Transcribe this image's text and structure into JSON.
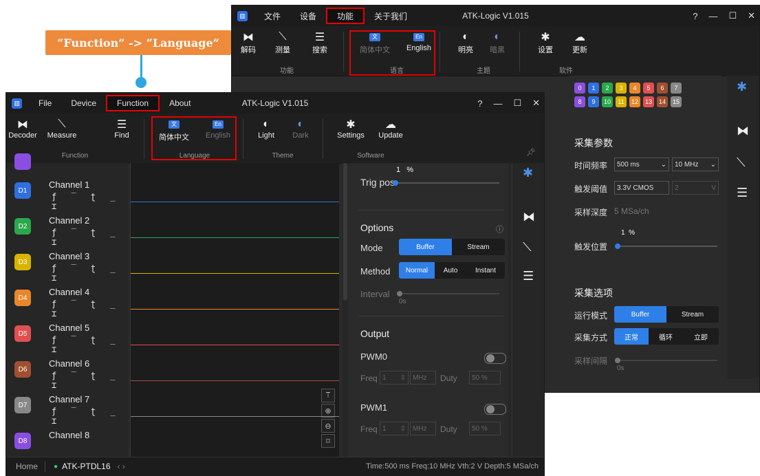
{
  "callout": {
    "text": "“Function” -> “Language”"
  },
  "back_window": {
    "title": "ATK-Logic  V1.015",
    "menu": [
      "文件",
      "设备",
      "功能",
      "关于我们"
    ],
    "controls": [
      "?",
      "—",
      "☐",
      "✕"
    ],
    "ribbon": {
      "decoder": "解码",
      "measure": "测量",
      "find": "搜索",
      "group_function": "功能",
      "lang_cn": "简体中文",
      "lang_en": "English",
      "group_language": "语言",
      "light": "明亮",
      "dark": "暗黑",
      "group_theme": "主题",
      "settings": "设置",
      "update": "更新",
      "group_software": "软件"
    },
    "channel_chips": [
      "0",
      "1",
      "2",
      "3",
      "4",
      "5",
      "6",
      "7",
      "8",
      "9",
      "10",
      "11",
      "12",
      "13",
      "14",
      "15"
    ],
    "chip_colors": [
      "#8a4fe0",
      "#2f6fe0",
      "#2aa84a",
      "#d8b400",
      "#e8872a",
      "#e05050",
      "#a05030",
      "#888888",
      "#8a4fe0",
      "#2f6fe0",
      "#2aa84a",
      "#d8b400",
      "#e8872a",
      "#e05050",
      "#a05030",
      "#888888"
    ],
    "acq_params_title": "采集参数",
    "time_freq_label": "时间频率",
    "time_value": "500 ms",
    "freq_value": "10 MHz",
    "trig_threshold_label": "触发阈值",
    "threshold_value": "3.3V CMOS",
    "threshold_num": "2",
    "threshold_unit": "V",
    "depth_label": "采样深度",
    "depth_value": "5 MSa/ch",
    "trig_pos_label": "触发位置",
    "trig_pos_value": "1",
    "trig_pos_unit": "%",
    "options_title": "采集选项",
    "run_mode_label": "运行模式",
    "run_modes": [
      "Buffer",
      "Stream"
    ],
    "method_label": "采集方式",
    "methods": [
      "正常",
      "循环",
      "立即"
    ],
    "interval_label": "采样间隔",
    "interval_value": "0s"
  },
  "front_window": {
    "title": "ATK-Logic  V1.015",
    "menu": [
      "File",
      "Device",
      "Function",
      "About"
    ],
    "controls": [
      "?",
      "—",
      "☐",
      "✕"
    ],
    "ribbon": {
      "decoder": "Decoder",
      "measure": "Measure",
      "find": "Find",
      "group_function": "Function",
      "lang_cn": "简体中文",
      "lang_en": "English",
      "group_language": "Language",
      "light": "Light",
      "dark": "Dark",
      "group_theme": "Theme",
      "settings": "Settings",
      "update": "Update",
      "group_software": "Software"
    },
    "channels": [
      {
        "badge": "D1",
        "name": "Channel 1",
        "color": "#2f6fe0"
      },
      {
        "badge": "D2",
        "name": "Channel 2",
        "color": "#2aa84a"
      },
      {
        "badge": "D3",
        "name": "Channel 3",
        "color": "#d8b400"
      },
      {
        "badge": "D4",
        "name": "Channel 4",
        "color": "#e8872a"
      },
      {
        "badge": "D5",
        "name": "Channel 5",
        "color": "#e05050"
      },
      {
        "badge": "D6",
        "name": "Channel 6",
        "color": "#a05030"
      },
      {
        "badge": "D7",
        "name": "Channel 7",
        "color": "#888888"
      },
      {
        "badge": "D8",
        "name": "Channel 8",
        "color": "#8a4fe0"
      }
    ],
    "trigger_icons": "ƒ ‾ ʈ _ ⌶",
    "panel": {
      "trig_pos_value": "1",
      "trig_pos_unit": "%",
      "trig_pos_label": "Trig pos",
      "options_title": "Options",
      "mode_label": "Mode",
      "modes": [
        "Buffer",
        "Stream"
      ],
      "method_label": "Method",
      "methods": [
        "Normal",
        "Auto",
        "Instant"
      ],
      "interval_label": "Interval",
      "interval_value": "0s",
      "output_title": "Output",
      "pwm0_label": "PWM0",
      "pwm1_label": "PWM1",
      "freq_label": "Freq",
      "freq_value": "1",
      "freq_unit": "MHz",
      "duty_label": "Duty",
      "duty_value": "50 %"
    },
    "status": {
      "home": "Home",
      "device": "ATK-PTDL16",
      "summary": "Time:500 ms   Freq:10 MHz   Vth:2 V   Depth:5 MSa/ch"
    }
  }
}
